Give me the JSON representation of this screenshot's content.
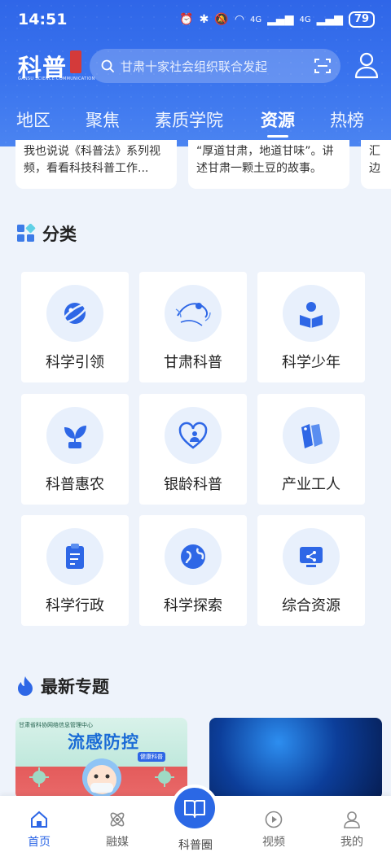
{
  "status": {
    "time": "14:51",
    "battery": "79",
    "network_1": "4G",
    "network_2": "4G"
  },
  "header": {
    "logo_text": "科普",
    "logo_sub": "GANSU SCIENCE COMMUNICATION",
    "search_placeholder": "甘肃十家社会组织联合发起",
    "tabs": [
      {
        "label": "地区"
      },
      {
        "label": "聚焦"
      },
      {
        "label": "素质学院"
      },
      {
        "label": "资源",
        "active": true
      },
      {
        "label": "热榜"
      }
    ]
  },
  "articles": [
    {
      "text": "我也说说《科普法》系列视频，看看科技科普工作..."
    },
    {
      "text": "“厚道甘肃，地道甘味”。讲述甘肃一颗土豆的故事。"
    },
    {
      "text": "汇边"
    }
  ],
  "categories": {
    "title": "分类",
    "items": [
      {
        "label": "科学引领",
        "icon": "planet-icon"
      },
      {
        "label": "甘肃科普",
        "icon": "flying-apsara-icon"
      },
      {
        "label": "科学少年",
        "icon": "reading-child-icon"
      },
      {
        "label": "科普惠农",
        "icon": "sprout-icon"
      },
      {
        "label": "银龄科普",
        "icon": "heart-person-icon"
      },
      {
        "label": "产业工人",
        "icon": "tags-icon"
      },
      {
        "label": "科学行政",
        "icon": "clipboard-icon"
      },
      {
        "label": "科学探索",
        "icon": "globe-icon"
      },
      {
        "label": "综合资源",
        "icon": "monitor-share-icon"
      }
    ]
  },
  "topics": {
    "title": "最新专题",
    "items": [
      {
        "title": "流感防控",
        "header": "甘肃省科协网络信息管理中心",
        "badge": "健康科普"
      },
      {
        "title": ""
      }
    ]
  },
  "bottom_nav": {
    "items": [
      {
        "label": "首页",
        "active": true
      },
      {
        "label": "融媒"
      },
      {
        "label": "科普圈"
      },
      {
        "label": "视频"
      },
      {
        "label": "我的"
      }
    ]
  },
  "colors": {
    "brand": "#2e67e6",
    "icon_bg": "#e8f0fc",
    "page_bg": "#eef3fb"
  }
}
